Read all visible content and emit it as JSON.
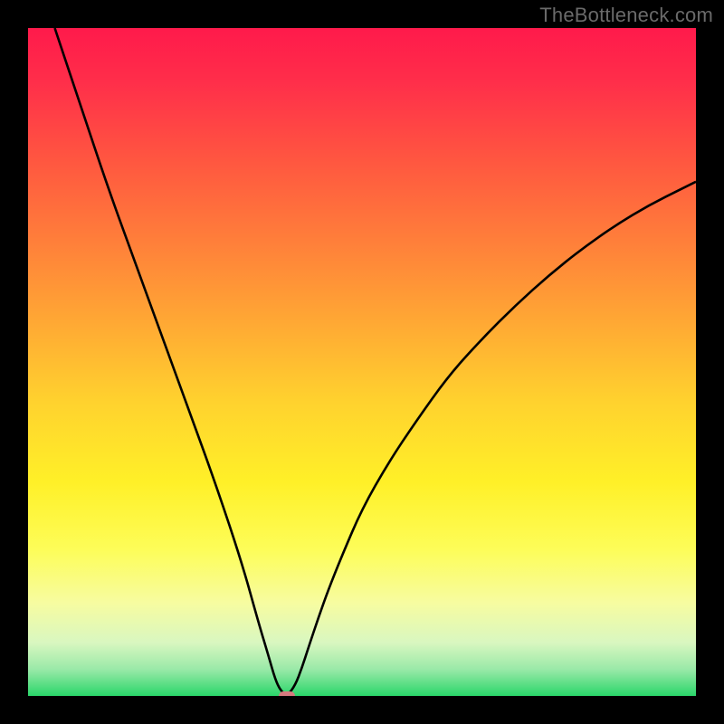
{
  "watermark": "TheBottleneck.com",
  "chart_data": {
    "type": "line",
    "title": "",
    "xlabel": "",
    "ylabel": "",
    "xlim": [
      0,
      100
    ],
    "ylim": [
      0,
      100
    ],
    "series": [
      {
        "name": "bottleneck-curve",
        "x": [
          4,
          8,
          12,
          16,
          20,
          24,
          28,
          32,
          34.5,
          36,
          37,
          37.8,
          38.8,
          40,
          41,
          42,
          43.5,
          45,
          47,
          50,
          54,
          58,
          63,
          68,
          73,
          78,
          83,
          88,
          93,
          98,
          100
        ],
        "values": [
          100,
          88,
          76,
          65,
          54,
          43,
          32,
          20,
          11,
          6,
          2.5,
          0.8,
          0,
          1.6,
          4.2,
          7.3,
          11.8,
          16,
          21,
          28,
          35,
          41,
          48,
          53.5,
          58.5,
          63,
          67,
          70.5,
          73.5,
          76,
          77
        ]
      }
    ],
    "background": {
      "type": "vertical-gradient",
      "top_color": "#ff1a4b",
      "bottom_color": "#2ad66a"
    },
    "marker": {
      "x": 38.8,
      "y": 0,
      "color": "#d67a7f"
    }
  }
}
